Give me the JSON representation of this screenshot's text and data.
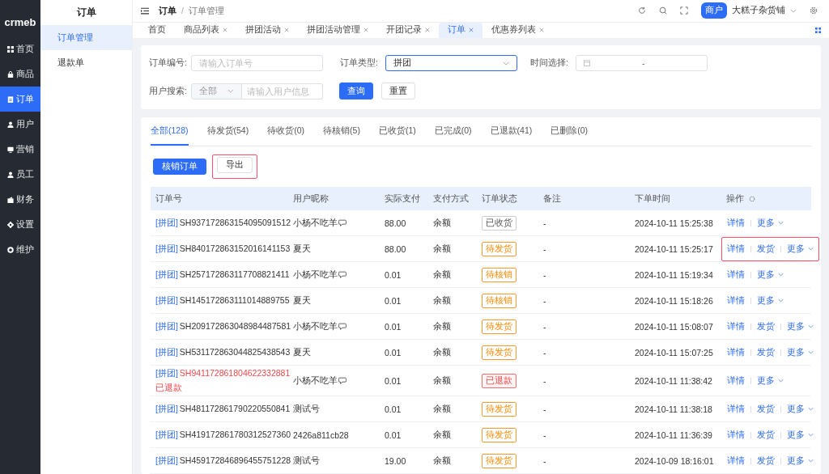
{
  "logo": "crmeb",
  "sidebar": {
    "items": [
      {
        "label": "首页",
        "selected": false
      },
      {
        "label": "商品",
        "selected": false
      },
      {
        "label": "订单",
        "selected": true
      },
      {
        "label": "用户",
        "selected": false
      },
      {
        "label": "营销",
        "selected": false
      },
      {
        "label": "员工",
        "selected": false
      },
      {
        "label": "财务",
        "selected": false
      },
      {
        "label": "设置",
        "selected": false
      },
      {
        "label": "维护",
        "selected": false
      }
    ]
  },
  "subnav": {
    "title": "订单",
    "items": [
      {
        "label": "订单管理",
        "selected": true
      },
      {
        "label": "退款单",
        "selected": false
      }
    ]
  },
  "breadcrumb": {
    "items": [
      "订单",
      "订单管理"
    ],
    "separator": "/"
  },
  "header": {
    "badge": "商户",
    "user": "大糕子杂货铺"
  },
  "page_tabs": [
    {
      "label": "首页",
      "closable": false,
      "selected": false
    },
    {
      "label": "商品列表",
      "closable": true,
      "selected": false
    },
    {
      "label": "拼团活动",
      "closable": true,
      "selected": false
    },
    {
      "label": "拼团活动管理",
      "closable": true,
      "selected": false
    },
    {
      "label": "开团记录",
      "closable": true,
      "selected": false
    },
    {
      "label": "订单",
      "closable": true,
      "selected": true
    },
    {
      "label": "优惠券列表",
      "closable": true,
      "selected": false
    }
  ],
  "filters": {
    "order_no": {
      "label": "订单编号:",
      "placeholder": "请输入订单号"
    },
    "order_type": {
      "label": "订单类型:",
      "value": "拼团"
    },
    "time": {
      "label": "时间选择:",
      "separator": "-"
    },
    "user": {
      "label": "用户搜索:",
      "scope": "全部",
      "placeholder": "请输入用户信息"
    },
    "buttons": [
      "查询",
      "重置"
    ]
  },
  "status_tabs": [
    {
      "label": "全部(128)",
      "selected": true
    },
    {
      "label": "待发货(54)",
      "selected": false
    },
    {
      "label": "待收货(0)",
      "selected": false
    },
    {
      "label": "待核销(5)",
      "selected": false
    },
    {
      "label": "已收货(1)",
      "selected": false
    },
    {
      "label": "已完成(0)",
      "selected": false
    },
    {
      "label": "已退款(41)",
      "selected": false
    },
    {
      "label": "已删除(0)",
      "selected": false
    }
  ],
  "actions": [
    {
      "label": "核销订单",
      "kind": "primary",
      "highlighted": false
    },
    {
      "label": "导出",
      "kind": "default",
      "highlighted": true
    }
  ],
  "table": {
    "columns": [
      "订单号",
      "用户昵称",
      "实际支付",
      "支付方式",
      "订单状态",
      "备注",
      "下单时间",
      "操作"
    ],
    "rows": [
      {
        "tag": "[拼团]",
        "order_no": "SH937172863154095091512",
        "refunded": false,
        "nickname": "小杨不吃羊",
        "user_icon": true,
        "paid": "88.00",
        "method": "余额",
        "status": {
          "label": "已收货",
          "kind": "neutral"
        },
        "remark": "-",
        "time": "2024-10-11 15:25:38",
        "ops": [
          "详情",
          "更多"
        ],
        "highlighted": false
      },
      {
        "tag": "[拼团]",
        "order_no": "SH840172863152016141153",
        "refunded": false,
        "nickname": "夏天",
        "user_icon": false,
        "paid": "88.00",
        "method": "余额",
        "status": {
          "label": "待发货",
          "kind": "warning"
        },
        "remark": "-",
        "time": "2024-10-11 15:25:17",
        "ops": [
          "详情",
          "发货",
          "更多"
        ],
        "highlighted": true
      },
      {
        "tag": "[拼团]",
        "order_no": "SH257172863117708821411",
        "refunded": false,
        "nickname": "小杨不吃羊",
        "user_icon": true,
        "paid": "0.01",
        "method": "余额",
        "status": {
          "label": "待核销",
          "kind": "warning"
        },
        "remark": "-",
        "time": "2024-10-11 15:19:34",
        "ops": [
          "详情",
          "更多"
        ],
        "highlighted": false
      },
      {
        "tag": "[拼团]",
        "order_no": "SH145172863111014889755",
        "refunded": false,
        "nickname": "夏天",
        "user_icon": false,
        "paid": "0.01",
        "method": "余额",
        "status": {
          "label": "待核销",
          "kind": "warning"
        },
        "remark": "-",
        "time": "2024-10-11 15:18:26",
        "ops": [
          "详情",
          "更多"
        ],
        "highlighted": false
      },
      {
        "tag": "[拼团]",
        "order_no": "SH209172863048984487581",
        "refunded": false,
        "nickname": "小杨不吃羊",
        "user_icon": true,
        "paid": "0.01",
        "method": "余额",
        "status": {
          "label": "待发货",
          "kind": "warning"
        },
        "remark": "-",
        "time": "2024-10-11 15:08:07",
        "ops": [
          "详情",
          "发货",
          "更多"
        ],
        "highlighted": false
      },
      {
        "tag": "[拼团]",
        "order_no": "SH531172863044825438543",
        "refunded": false,
        "nickname": "夏天",
        "user_icon": false,
        "paid": "0.01",
        "method": "余额",
        "status": {
          "label": "待发货",
          "kind": "warning"
        },
        "remark": "-",
        "time": "2024-10-11 15:07:25",
        "ops": [
          "详情",
          "发货",
          "更多"
        ],
        "highlighted": false
      },
      {
        "tag": "[拼团]",
        "order_no": "SH941172861804622332881",
        "refunded": true,
        "refund_note": "已退款",
        "nickname": "小杨不吃羊",
        "user_icon": true,
        "paid": "0.01",
        "method": "余额",
        "status": {
          "label": "已退款",
          "kind": "danger"
        },
        "remark": "-",
        "time": "2024-10-11 11:38:42",
        "ops": [
          "详情",
          "更多"
        ],
        "highlighted": false
      },
      {
        "tag": "[拼团]",
        "order_no": "SH481172861790220550841",
        "refunded": false,
        "nickname": "测试号",
        "user_icon": false,
        "paid": "0.01",
        "method": "余额",
        "status": {
          "label": "待发货",
          "kind": "warning"
        },
        "remark": "-",
        "time": "2024-10-11 11:38:18",
        "ops": [
          "详情",
          "发货",
          "更多"
        ],
        "highlighted": false
      },
      {
        "tag": "[拼团]",
        "order_no": "SH419172861780312527360",
        "refunded": false,
        "nickname": "2426a811cb28",
        "user_icon": false,
        "paid": "0.01",
        "method": "余额",
        "status": {
          "label": "待发货",
          "kind": "warning"
        },
        "remark": "-",
        "time": "2024-10-11 11:36:39",
        "ops": [
          "详情",
          "发货",
          "更多"
        ],
        "highlighted": false
      },
      {
        "tag": "[拼团]",
        "order_no": "SH459172846896455751228",
        "refunded": false,
        "nickname": "测试号",
        "user_icon": false,
        "paid": "19.00",
        "method": "余额",
        "status": {
          "label": "待发货",
          "kind": "warning"
        },
        "remark": "-",
        "time": "2024-10-09 18:16:01",
        "ops": [
          "详情",
          "发货",
          "更多"
        ],
        "highlighted": false
      }
    ]
  }
}
